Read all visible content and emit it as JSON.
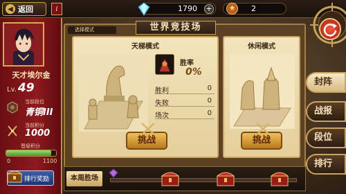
{
  "topbar": {
    "back_label": "返回",
    "info_label": "i",
    "gems": "1790",
    "medals": "2"
  },
  "player": {
    "name": "天才埃尔金",
    "level_prefix": "Lv.",
    "level": "49",
    "rank_label": "当前段位",
    "rank": "青铜III",
    "points_label": "当前积分",
    "points": "1000",
    "promo_label": "晋级积分",
    "promo_min": "0",
    "promo_max": "1100",
    "promo_progress": 0.9,
    "rank_reward_label": "排行奖励"
  },
  "main": {
    "title": "世界竞技场",
    "mode_tab": "选择模式",
    "ladder": {
      "title": "天梯模式",
      "winrate_label": "胜率",
      "winrate": "0%",
      "rows": [
        {
          "label": "胜利",
          "value": "0"
        },
        {
          "label": "失败",
          "value": "0"
        },
        {
          "label": "场次",
          "value": "0"
        }
      ],
      "challenge": "挑战"
    },
    "casual": {
      "title": "休闲模式",
      "challenge": "挑战"
    }
  },
  "weekly": {
    "label": "本周胜场"
  },
  "side": {
    "formation": "封阵",
    "battle_report": "战报",
    "rank_title": "段位",
    "leaderboard": "排行"
  },
  "colors": {
    "panel_red": "#8e1a1e",
    "gold_border": "#caa460",
    "card_bg": "#f3e4bc"
  }
}
